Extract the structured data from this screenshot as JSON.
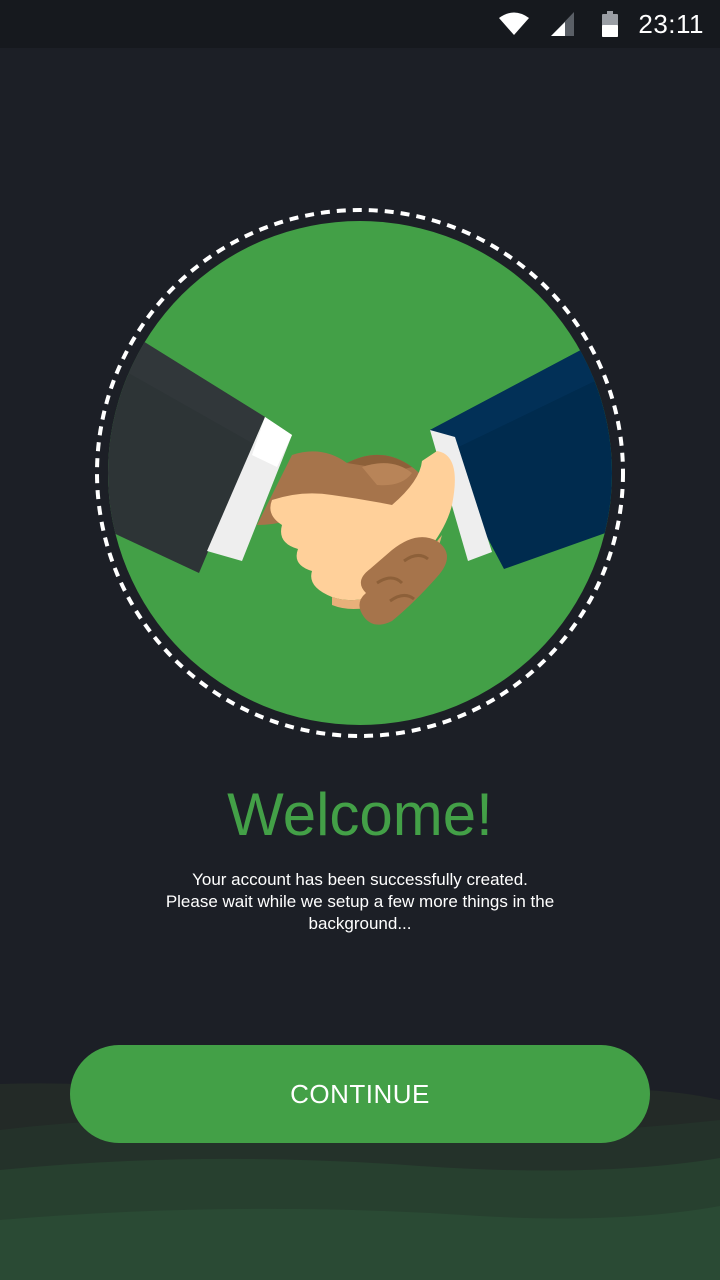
{
  "status_bar": {
    "time": "23:11",
    "icons": [
      "wifi-icon",
      "cell-signal-icon",
      "battery-icon"
    ]
  },
  "hero": {
    "illustration": "handshake-illustration",
    "colors": {
      "circle": "#43a047",
      "dashed_ring": "#ffffff",
      "left_sleeve": "#2d3436",
      "right_sleeve": "#002b4e",
      "cuff": "#eeeeee",
      "skin_light": "#ffd09a",
      "skin_dark": "#a6744b"
    }
  },
  "welcome": {
    "title": "Welcome!",
    "line1": "Your account has been successfully created.",
    "line2": "Please wait while we setup a few more things in the",
    "line3": "background..."
  },
  "actions": {
    "continue_label": "CONTINUE"
  },
  "colors": {
    "background": "#1c1f26",
    "accent": "#43a047",
    "text": "#ffffff"
  }
}
